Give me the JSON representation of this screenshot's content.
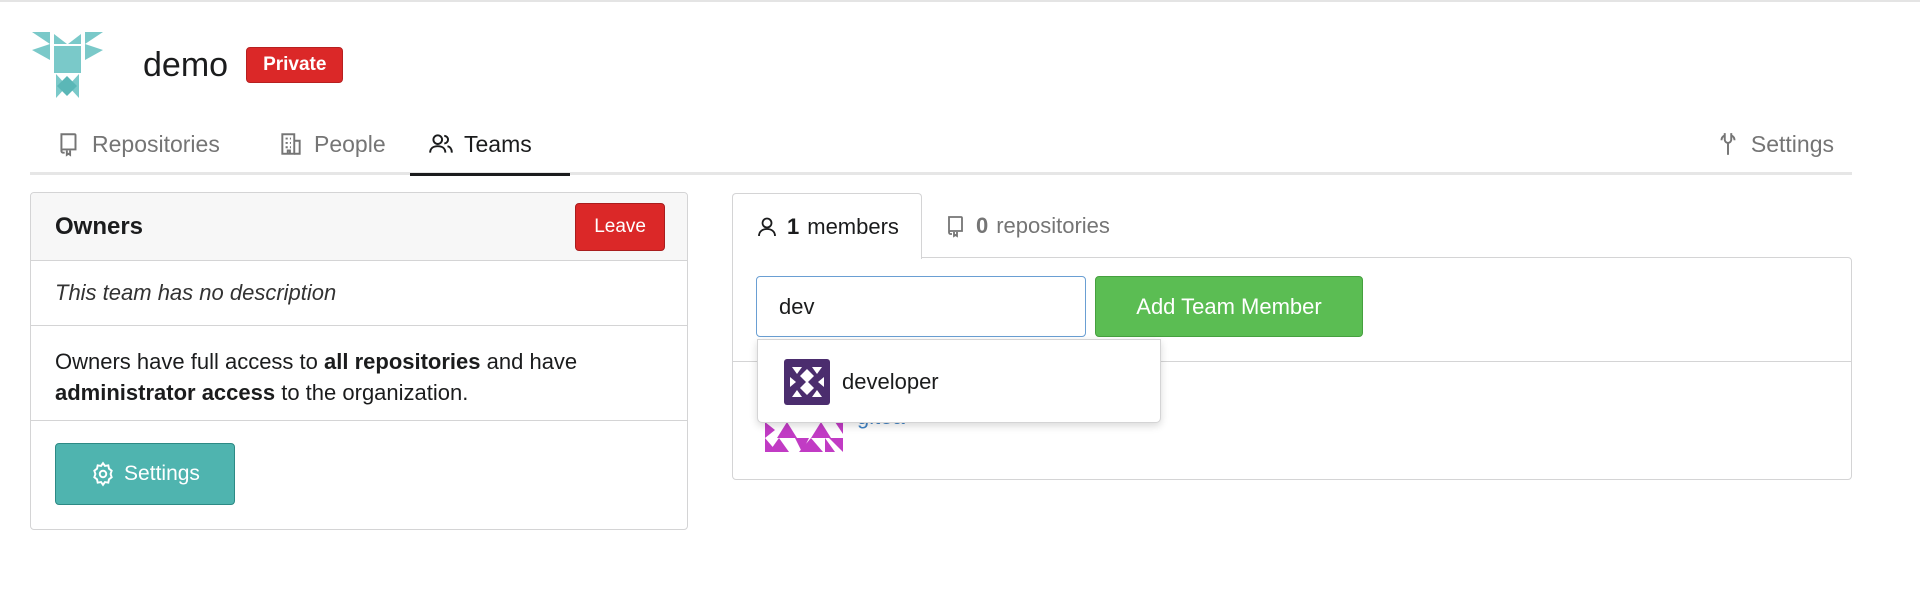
{
  "org": {
    "name": "demo",
    "visibility_badge": "Private"
  },
  "nav": {
    "repositories": "Repositories",
    "people": "People",
    "teams": "Teams",
    "settings": "Settings"
  },
  "team": {
    "name": "Owners",
    "leave_label": "Leave",
    "description": "This team has no description",
    "info_part1": "Owners have full access to ",
    "info_bold1": "all repositories",
    "info_part2": " and have ",
    "info_bold2": "administrator access",
    "info_part3": " to the organization.",
    "settings_label": "Settings"
  },
  "tabs": {
    "members_count": "1",
    "members_label": "members",
    "repos_count": "0",
    "repos_label": "repositories"
  },
  "add_member": {
    "input_value": "dev",
    "button_label": "Add Team Member"
  },
  "dropdown": {
    "items": [
      {
        "label": "developer"
      }
    ]
  },
  "members": [
    {
      "name": "gitea"
    }
  ],
  "colors": {
    "private_badge": "#db2828",
    "leave_button": "#db2828",
    "settings_button": "#4fb4af",
    "add_button": "#5bbd53",
    "link": "#4183c4",
    "org_avatar": "#7ac9c9",
    "dropdown_avatar": "#4b2d6e",
    "member_avatar": "#c13bc4"
  }
}
